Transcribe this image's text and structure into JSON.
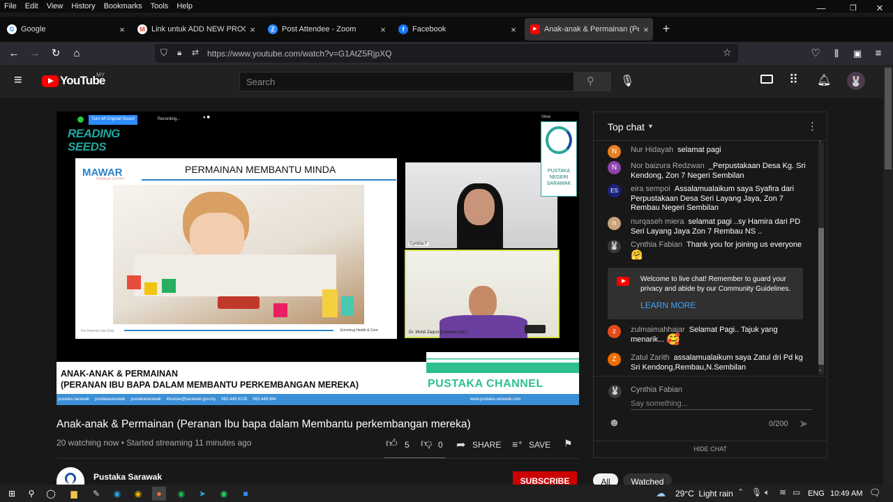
{
  "menubar": {
    "items": [
      "File",
      "Edit",
      "View",
      "History",
      "Bookmarks",
      "Tools",
      "Help"
    ]
  },
  "tabs": [
    {
      "title": "Google",
      "icon": "G",
      "color": "#ffffff"
    },
    {
      "title": "Link untuk ADD NEW PROGRAM",
      "icon": "M",
      "color": "#ea4335"
    },
    {
      "title": "Post Attendee - Zoom",
      "icon": "Z",
      "color": "#2d8cff"
    },
    {
      "title": "Facebook",
      "icon": "f",
      "color": "#1877f2"
    },
    {
      "title": "Anak-anak & Permainan (Peran",
      "icon": "▶",
      "color": "#ff0000"
    }
  ],
  "new_tab_label": "+",
  "url": "https://www.youtube.com/watch?v=G1AtZ5RjpXQ",
  "youtube": {
    "logo_text": "YouTube",
    "region": "MY",
    "search_placeholder": "Search"
  },
  "video": {
    "zoom_bar": {
      "sound_btn": "Turn off Original Sound",
      "recording": "Recording...",
      "view": "View"
    },
    "reading_seeds": "READING SEEDS",
    "slide_logo": "MAWAR",
    "slide_logo_sub": "Medical Centre",
    "slide_title": "PERMAINAN MEMBANTU MINDA",
    "slide_footer_left": "For Internal Use Only",
    "slide_footer_right": "Enriching Health & Care",
    "pustaka_logo": "PUSTAKA NEGERI SARAWAK",
    "speaker1": "Cynthia F",
    "speaker2": "Dr. Mohd Zaqrul (Paediatrician)",
    "banner_line1": "ANAK-ANAK & PERMAINAN",
    "banner_line2": "(PERANAN IBU BAPA DALAM  MEMBANTU PERKEMBANGAN MEREKA)",
    "channel_brand": "PUSTAKA CHANNEL",
    "bottom_bar": [
      "pustaka.sarawak",
      "pustakasarawak",
      "pustakasarawak",
      "librarian@sarawak.gov.my",
      "082-449 9126",
      "082-449 944",
      "www.pustaka-sarawak.com"
    ]
  },
  "title": "Anak-anak & Permainan (Peranan Ibu bapa dalam Membantu perkembangan mereka)",
  "meta": "20 watching now • Started streaming 11 minutes ago",
  "actions": {
    "likes": "5",
    "dislikes": "0",
    "share": "SHARE",
    "save": "SAVE"
  },
  "channel": {
    "name": "Pustaka Sarawak",
    "subscribe": "SUBSCRIBE"
  },
  "chat": {
    "header": "Top chat",
    "messages": [
      {
        "name": "Nur Hidayah",
        "text": "selamat pagi",
        "avatar": "N",
        "color": "#e67e22"
      },
      {
        "name": "Nor baizura Redzwan",
        "text": "_Perpustakaan Desa Kg. Sri Kendong, Zon 7 Negeri Sembilan",
        "avatar": "N",
        "color": "#8e44ad"
      },
      {
        "name": "eira sempoi",
        "text": "Assalamualaikum saya Syafira dari Perpustakaan Desa Seri Layang Jaya, Zon 7 Rembau Negeri Sembilan",
        "avatar": "ES",
        "color": "#1a237e"
      },
      {
        "name": "nurqaseh miera",
        "text": "selamat pagi ..sy Hamira dari PD Seri Layang Jaya Zon 7 Rembau NS ..",
        "avatar": "n",
        "color": "#c8a27a"
      },
      {
        "name": "Cynthia Fabian",
        "text": "Thank you for joining us everyone",
        "avatar": "🐰",
        "color": "#3a3a3a"
      }
    ],
    "welcome": "Welcome to live chat! Remember to guard your privacy and abide by our Community Guidelines.",
    "learn_more": "LEARN MORE",
    "messages2": [
      {
        "name": "zulmaimahhajar",
        "text": "Selamat Pagi.. Tajuk yang menarik...",
        "avatar": "z",
        "color": "#e64a19"
      },
      {
        "name": "Zatul Zarith",
        "text": "assalamualaikum saya Zatul dri Pd kg Sri Kendong,Rembau,N.Sembilan",
        "avatar": "Z",
        "color": "#ef6c00"
      }
    ],
    "input_user": "Cynthia Fabian",
    "input_placeholder": "Say something...",
    "counter": "0/200",
    "hide_chat": "HIDE CHAT"
  },
  "chips": [
    "All",
    "Watched"
  ],
  "taskbar": {
    "weather": "29°C  Light rain",
    "lang": "ENG",
    "time": "10:49 AM"
  }
}
